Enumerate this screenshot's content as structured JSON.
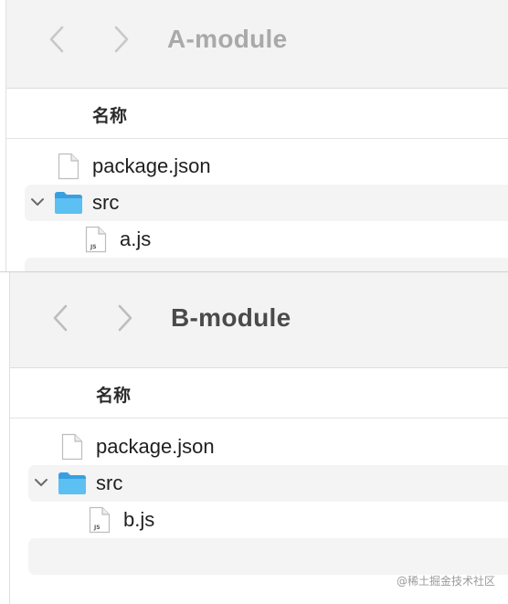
{
  "windows": [
    {
      "title": "A-module",
      "column_header": "名称",
      "files": [
        {
          "name": "package.json",
          "type": "file",
          "badge": ""
        },
        {
          "name": "src",
          "type": "folder",
          "expanded": true
        },
        {
          "name": "a.js",
          "type": "file",
          "badge": "JS"
        }
      ]
    },
    {
      "title": "B-module",
      "column_header": "名称",
      "files": [
        {
          "name": "package.json",
          "type": "file",
          "badge": ""
        },
        {
          "name": "src",
          "type": "folder",
          "expanded": true
        },
        {
          "name": "b.js",
          "type": "file",
          "badge": "JS"
        }
      ]
    }
  ],
  "watermark": "@稀土掘金技术社区",
  "colors": {
    "folder": "#4fb3ec",
    "toolbar": "#f3f3f3",
    "stripe": "#f4f4f4",
    "title_inactive": "#a9a9a9",
    "title_active": "#4a4a4a"
  }
}
